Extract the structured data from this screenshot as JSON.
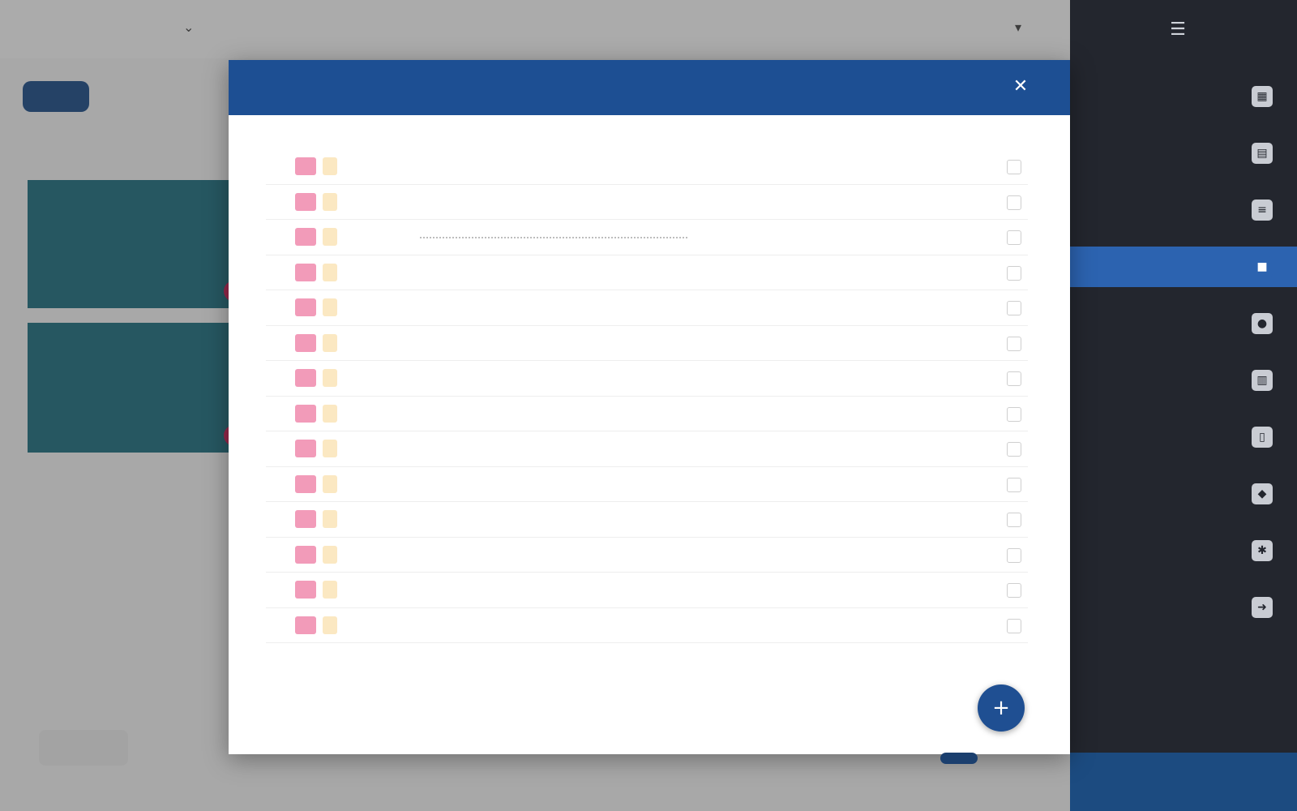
{
  "app": {
    "title": "",
    "user": "",
    "badge": "",
    "colors": {
      "topbar": "#f5f5f5",
      "card": "#1f6f7f",
      "badge": "#1d4d86"
    }
  },
  "sidebar": {
    "items": [
      {
        "label": "",
        "icon": "dashboard-icon"
      },
      {
        "label": "",
        "icon": "calendar-icon"
      },
      {
        "label": "",
        "icon": "list-icon"
      },
      {
        "label": "",
        "icon": "folder-icon",
        "active": true
      },
      {
        "label": "",
        "icon": "users-icon"
      },
      {
        "label": "",
        "icon": "chart-icon"
      },
      {
        "label": "",
        "icon": "document-icon"
      },
      {
        "label": "",
        "icon": "tag-icon"
      },
      {
        "label": "",
        "icon": "settings-icon"
      },
      {
        "label": "",
        "icon": "logout-icon"
      }
    ],
    "bottom_label": "",
    "colors": {
      "background": "#23262e",
      "active": "#2c63b0",
      "bottom": "#1c4b80"
    }
  },
  "modal": {
    "title": "",
    "close_icon": "close-icon",
    "rows": [
      {
        "name": "",
        "num": ""
      },
      {
        "name": "",
        "num": ""
      },
      {
        "name": "",
        "num": ""
      },
      {
        "name": "",
        "num": ""
      },
      {
        "name": "",
        "num": ""
      },
      {
        "name": "",
        "num": ""
      },
      {
        "name": "",
        "num": ""
      },
      {
        "name": "",
        "num": ""
      },
      {
        "name": "",
        "num": ""
      },
      {
        "name": "",
        "num": ""
      },
      {
        "name": "",
        "num": ""
      },
      {
        "name": "",
        "num": ""
      },
      {
        "name": "",
        "num": ""
      },
      {
        "name": "",
        "num": ""
      }
    ],
    "fab_icon": "add-icon",
    "colors": {
      "header": "#1d4f93",
      "swatch": "#f29bb9",
      "swatch2": "#fbe8c2",
      "fab": "#1f4f92"
    }
  }
}
